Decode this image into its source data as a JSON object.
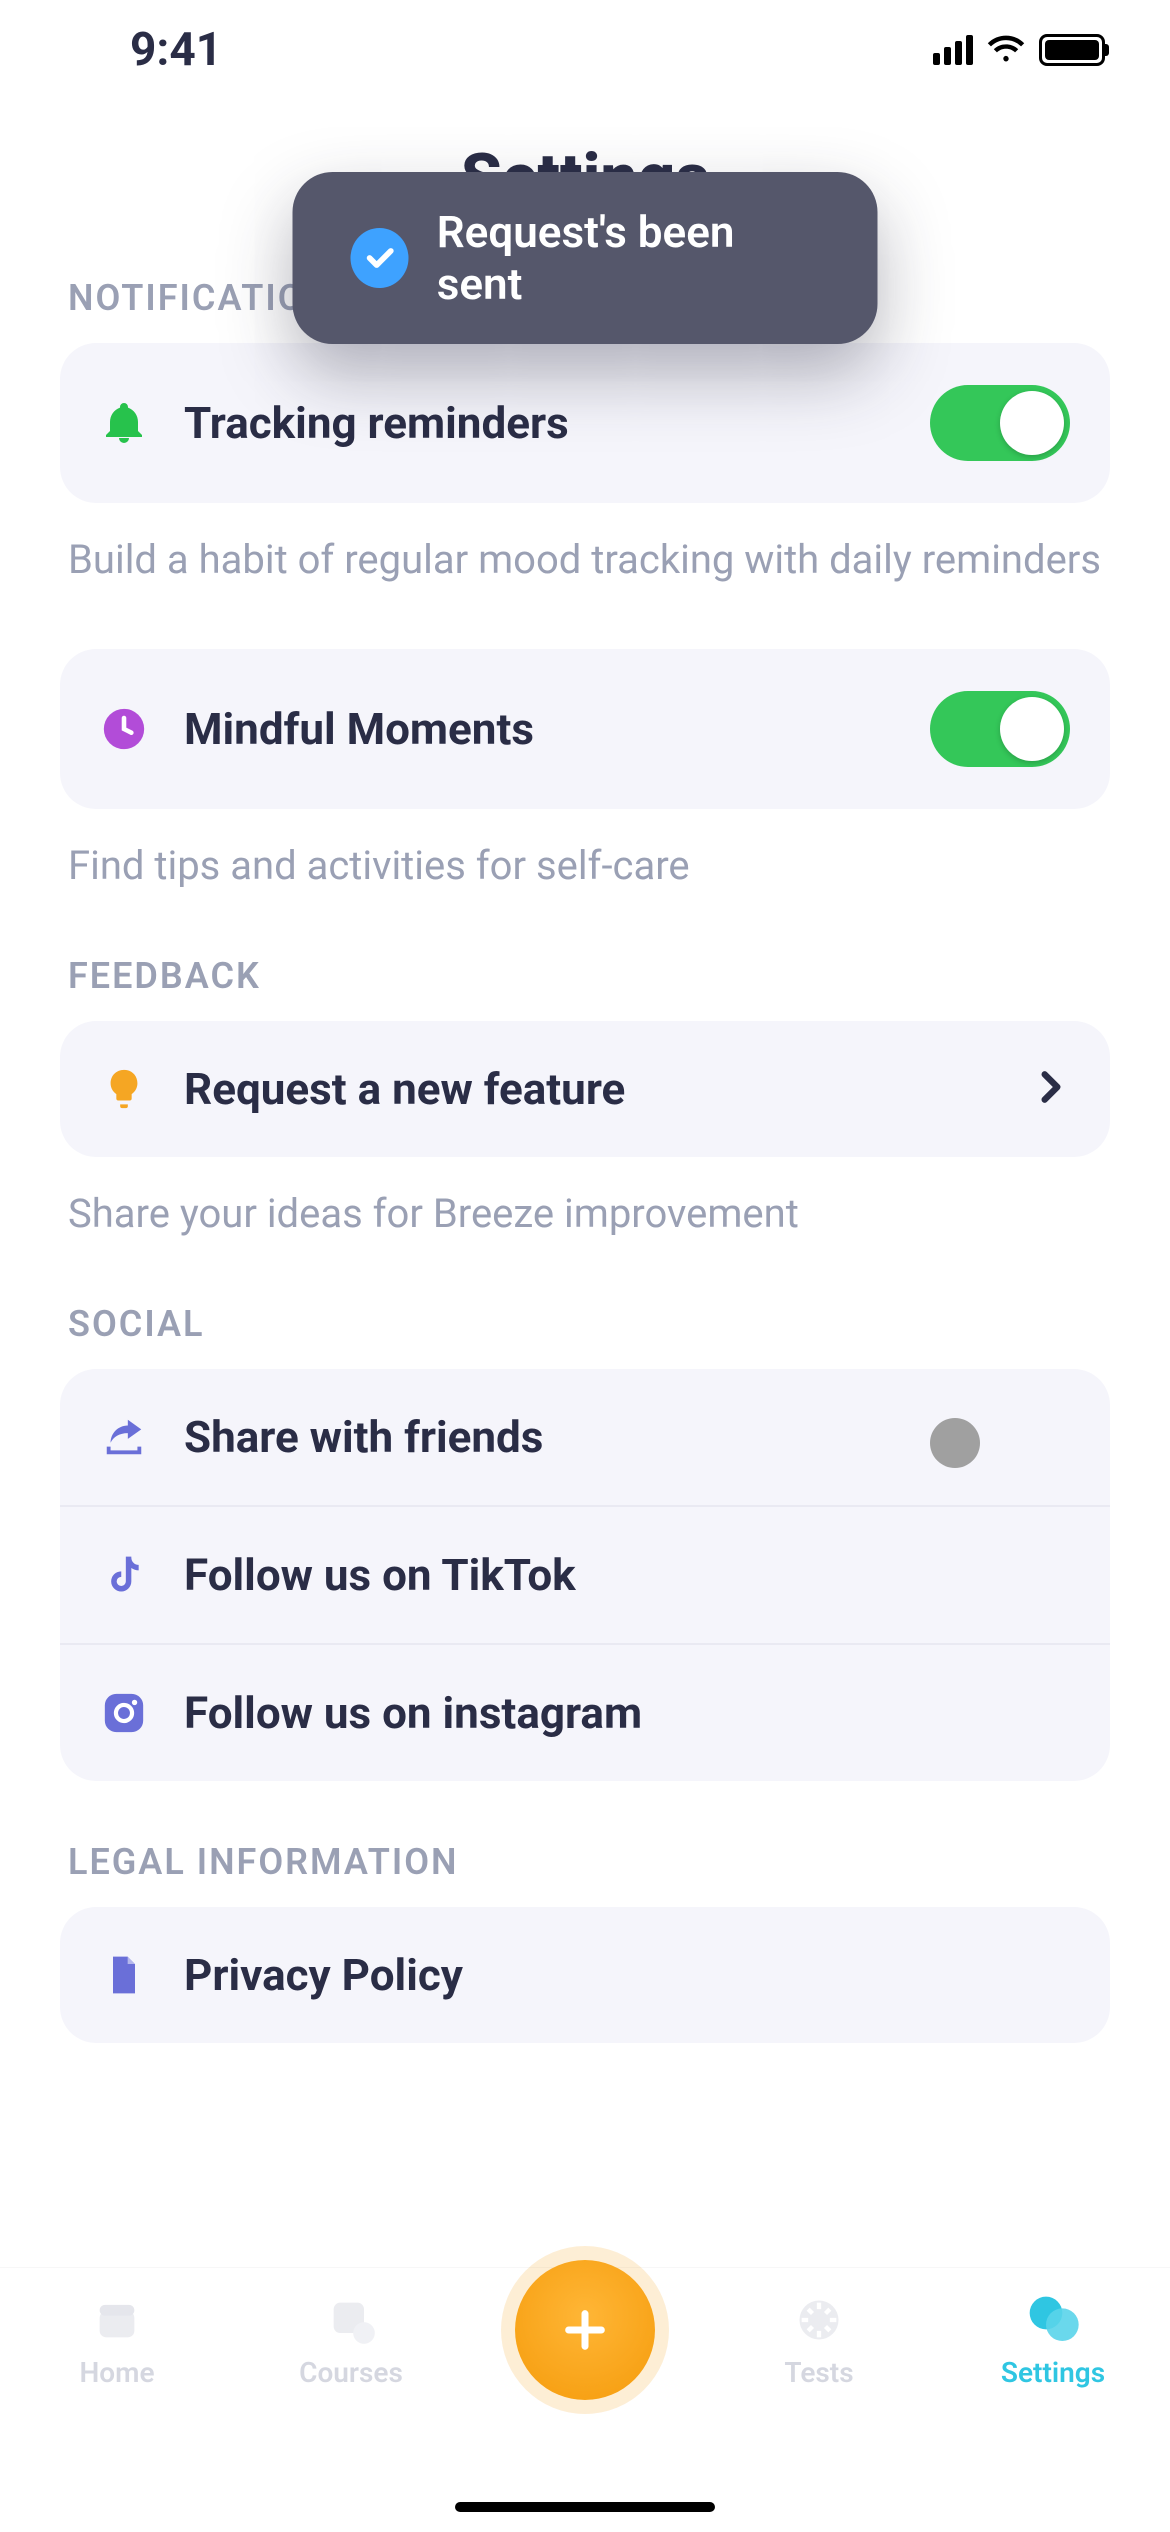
{
  "status": {
    "time": "9:41"
  },
  "header": {
    "title": "Settings"
  },
  "toast": {
    "message": "Request's been sent"
  },
  "sections": {
    "notifications": {
      "header": "NOTIFICATIONS",
      "tracking": {
        "label": "Tracking reminders",
        "helper": "Build a habit of regular mood tracking with daily reminders",
        "enabled": true
      },
      "mindful": {
        "label": "Mindful Moments",
        "helper": "Find tips and activities for self-care",
        "enabled": true
      }
    },
    "feedback": {
      "header": "FEEDBACK",
      "request": {
        "label": "Request a new feature",
        "helper": "Share your ideas for Breeze improvement"
      }
    },
    "social": {
      "header": "SOCIAL",
      "share": {
        "label": "Share with friends"
      },
      "tiktok": {
        "label": "Follow us on TikTok"
      },
      "instagram": {
        "label": "Follow us on instagram"
      }
    },
    "legal": {
      "header": "LEGAL INFORMATION",
      "privacy": {
        "label": "Privacy Policy"
      }
    }
  },
  "tabs": {
    "home": "Home",
    "courses": "Courses",
    "tests": "Tests",
    "settings": "Settings"
  },
  "colors": {
    "accent_green": "#34c759",
    "accent_teal": "#2fc6e2",
    "icon_bell": "#27c24c",
    "icon_clock": "#b24cd8",
    "icon_bulb": "#f5a623",
    "icon_indigo": "#6a6fd8",
    "text_dark": "#2a2d46",
    "text_muted": "#9aa0b4",
    "card_bg": "#f5f5fb",
    "toast_bg": "#55576b"
  }
}
